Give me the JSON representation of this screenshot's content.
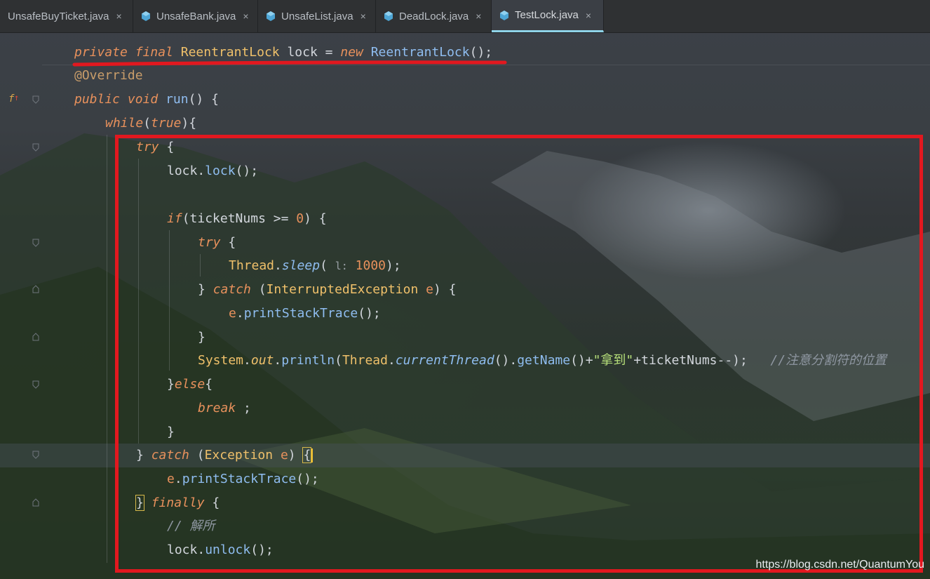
{
  "tabs": [
    {
      "label": "UnsafeBuyTicket.java",
      "active": false
    },
    {
      "label": "UnsafeBank.java",
      "active": false
    },
    {
      "label": "UnsafeList.java",
      "active": false
    },
    {
      "label": "DeadLock.java",
      "active": false
    },
    {
      "label": "TestLock.java",
      "active": true
    }
  ],
  "close_glyph": "×",
  "code": {
    "l1": {
      "private": "private",
      "final": "final",
      "type": "ReentrantLock",
      "var": "lock",
      "eq": "=",
      "new": "new",
      "ctor": "ReentrantLock",
      "end": "();"
    },
    "l2": {
      "annot": "@Override"
    },
    "l3": {
      "public": "public",
      "void": "void",
      "name": "run",
      "rest": "() {"
    },
    "l4": {
      "while": "while",
      "open": "(",
      "true": "true",
      "close": "){"
    },
    "l5": {
      "try": "try",
      "rest": "{"
    },
    "l6": {
      "obj": "lock",
      "dot": ".",
      "method": "lock",
      "rest": "();"
    },
    "l8": {
      "if": "if",
      "open": "(",
      "var": "ticketNums",
      "op": ">=",
      "num": "0",
      "close": ") {"
    },
    "l9": {
      "try": "try",
      "rest": "{"
    },
    "l10": {
      "cls": "Thread",
      "dot": ".",
      "method": "sleep",
      "open": "(",
      "hint": "l:",
      "num": "1000",
      "close": ");"
    },
    "l11": {
      "brace": "}",
      "catch": "catch",
      "open": "(",
      "type": "InterruptedException",
      "var": "e",
      "close": ") {"
    },
    "l12": {
      "var": "e",
      "dot": ".",
      "method": "printStackTrace",
      "rest": "();"
    },
    "l13": {
      "brace": "}"
    },
    "l14": {
      "cls": "System",
      "dot1": ".",
      "out": "out",
      "dot2": ".",
      "println": "println",
      "open": "(",
      "cls2": "Thread",
      "dot3": ".",
      "current": "currentThread",
      "mid": "().",
      "getName": "getName",
      "plus1": "()+",
      "str": "\"拿到\"",
      "plus2": "+",
      "var": "ticketNums",
      "tail": "--);",
      "comment": "//注意分割符的位置"
    },
    "l15": {
      "brace": "}",
      "else": "else",
      "rest": "{"
    },
    "l16": {
      "break": "break",
      "rest": ";"
    },
    "l17": {
      "brace": "}"
    },
    "l18": {
      "brace": "}",
      "catch": "catch",
      "open": "(",
      "type": "Exception",
      "var": "e",
      "close": ")",
      "open_brace": "{"
    },
    "l19": {
      "var": "e",
      "dot": ".",
      "method": "printStackTrace",
      "rest": "();"
    },
    "l20": {
      "brace": "}",
      "finally": "finally",
      "rest": "{"
    },
    "l21": {
      "comment": "// 解所"
    },
    "l22": {
      "obj": "lock",
      "dot": ".",
      "method": "unlock",
      "rest": "();"
    }
  },
  "watermark": "https://blog.csdn.net/QuantumYou",
  "colors": {
    "highlight_box": "#e2181f",
    "active_tab_underline": "#8fd3e8",
    "keyword": "#e8915c",
    "type": "#efc06a",
    "method": "#8fbdf0",
    "string": "#b7e07a"
  }
}
